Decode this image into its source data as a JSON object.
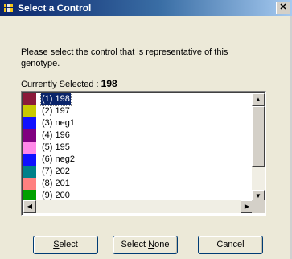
{
  "window": {
    "title": "Select a Control",
    "close_glyph": "✕"
  },
  "prompt": "Please select the control that is representative of this genotype.",
  "current": {
    "label": "Currently Selected :",
    "value": "198"
  },
  "list": {
    "items": [
      {
        "label": "(1) 198",
        "color": "#8b1a3a",
        "selected": true
      },
      {
        "label": "(2) 197",
        "color": "#c8c800"
      },
      {
        "label": "(3) neg1",
        "color": "#1010ff"
      },
      {
        "label": "(4) 196",
        "color": "#800080"
      },
      {
        "label": "(5) 195",
        "color": "#ff88e8"
      },
      {
        "label": "(6) neg2",
        "color": "#1010ff"
      },
      {
        "label": "(7) 202",
        "color": "#00808a"
      },
      {
        "label": "(8) 201",
        "color": "#ff8080"
      },
      {
        "label": "(9) 200",
        "color": "#00a000"
      }
    ]
  },
  "buttons": {
    "select": {
      "mnemonic": "S",
      "rest": "elect"
    },
    "select_none": {
      "pre": "Select ",
      "mnemonic": "N",
      "rest": "one"
    },
    "cancel": "Cancel"
  },
  "icons": {
    "title": "grid-app-icon",
    "scroll_up": "▲",
    "scroll_down": "▼",
    "scroll_left": "◀",
    "scroll_right": "▶"
  }
}
